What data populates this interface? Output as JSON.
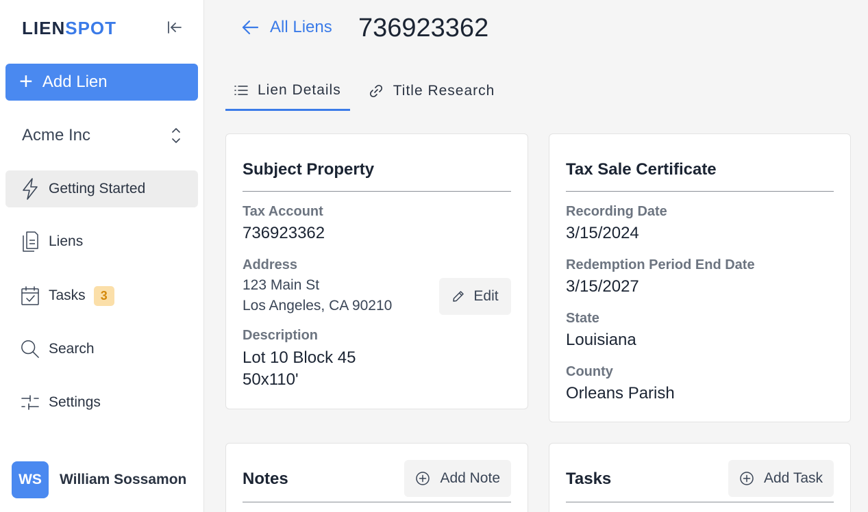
{
  "logo": {
    "part1": "LIEN",
    "part2": "SPOT"
  },
  "sidebar": {
    "add_lien_label": "Add Lien",
    "org_name": "Acme Inc",
    "items": [
      {
        "label": "Getting Started",
        "icon": "lightning-icon",
        "active": true
      },
      {
        "label": "Liens",
        "icon": "document-icon"
      },
      {
        "label": "Tasks",
        "icon": "calendar-check-icon",
        "badge": "3"
      },
      {
        "label": "Search",
        "icon": "search-icon"
      },
      {
        "label": "Settings",
        "icon": "sliders-icon"
      }
    ],
    "user": {
      "initials": "WS",
      "name": "William Sossamon"
    }
  },
  "header": {
    "back_label": "All Liens",
    "lien_id": "736923362"
  },
  "tabs": [
    {
      "label": "Lien Details",
      "active": true
    },
    {
      "label": "Title Research"
    }
  ],
  "subject_property": {
    "title": "Subject Property",
    "tax_account_label": "Tax Account",
    "tax_account": "736923362",
    "address_label": "Address",
    "address_line1": "123 Main St",
    "address_line2": "Los Angeles, CA 90210",
    "description_label": "Description",
    "description_line1": "Lot 10 Block 45",
    "description_line2": "50x110'",
    "edit_label": "Edit"
  },
  "tax_sale_certificate": {
    "title": "Tax Sale Certificate",
    "recording_date_label": "Recording Date",
    "recording_date": "3/15/2024",
    "redemption_label": "Redemption Period End Date",
    "redemption_date": "3/15/2027",
    "state_label": "State",
    "state": "Louisiana",
    "county_label": "County",
    "county": "Orleans Parish"
  },
  "notes": {
    "title": "Notes",
    "add_label": "Add Note"
  },
  "tasks_card": {
    "title": "Tasks",
    "add_label": "Add Task"
  },
  "colors": {
    "accent": "#4a89f0",
    "badge_bg": "#fbdfa9",
    "badge_text": "#d4890b"
  }
}
